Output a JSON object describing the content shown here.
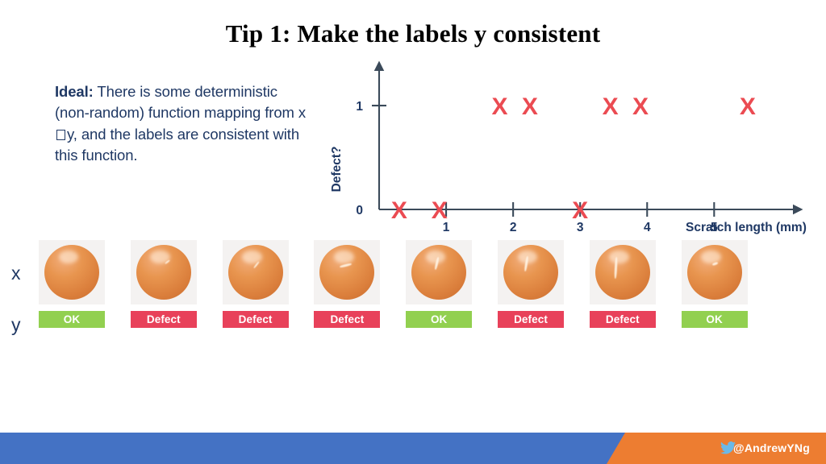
{
  "slide": {
    "title": "Tip 1: Make the labels y consistent",
    "background": "#ffffff"
  },
  "ideal_note": {
    "lead": "Ideal:",
    "body_part1": " There is some deterministic (non-random) function mapping from x",
    "arrow_glyph": "missing-glyph-box",
    "body_part2": "y, and the labels are consistent with this function.",
    "color": "#1F3864"
  },
  "chart_data": {
    "type": "scatter",
    "title": "",
    "xlabel": "Scratch length (mm)",
    "ylabel": "Defect?",
    "x_ticks": [
      "1",
      "2",
      "3",
      "4",
      "5"
    ],
    "x_tick_values": [
      1,
      2,
      3,
      4,
      5
    ],
    "y_ticks": [
      "0",
      "1"
    ],
    "y_tick_values": [
      0,
      1
    ],
    "xlim": [
      0,
      6.2
    ],
    "ylim": [
      0,
      1.35
    ],
    "grid": false,
    "legend": null,
    "marker": "X",
    "marker_color": "#EB4B52",
    "axis_color": "#3B4A5A",
    "points": [
      {
        "x": 0.3,
        "y": 0
      },
      {
        "x": 0.9,
        "y": 0
      },
      {
        "x": 3.0,
        "y": 0
      },
      {
        "x": 1.8,
        "y": 1
      },
      {
        "x": 2.25,
        "y": 1
      },
      {
        "x": 3.45,
        "y": 1
      },
      {
        "x": 3.9,
        "y": 1
      },
      {
        "x": 5.5,
        "y": 1
      }
    ]
  },
  "examples": {
    "row_label_x": "x",
    "row_label_y": "y",
    "ok_color": "#92D050",
    "defect_color": "#E8415A",
    "items": [
      {
        "label": "OK",
        "status": "ok"
      },
      {
        "label": "Defect",
        "status": "defect"
      },
      {
        "label": "Defect",
        "status": "defect"
      },
      {
        "label": "Defect",
        "status": "defect"
      },
      {
        "label": "OK",
        "status": "ok"
      },
      {
        "label": "Defect",
        "status": "defect"
      },
      {
        "label": "Defect",
        "status": "defect"
      },
      {
        "label": "OK",
        "status": "ok"
      }
    ]
  },
  "footer": {
    "handle": "@AndrewYNg",
    "icon": "twitter-bird-icon",
    "blue": "#4472C4",
    "orange": "#ED7D31"
  }
}
